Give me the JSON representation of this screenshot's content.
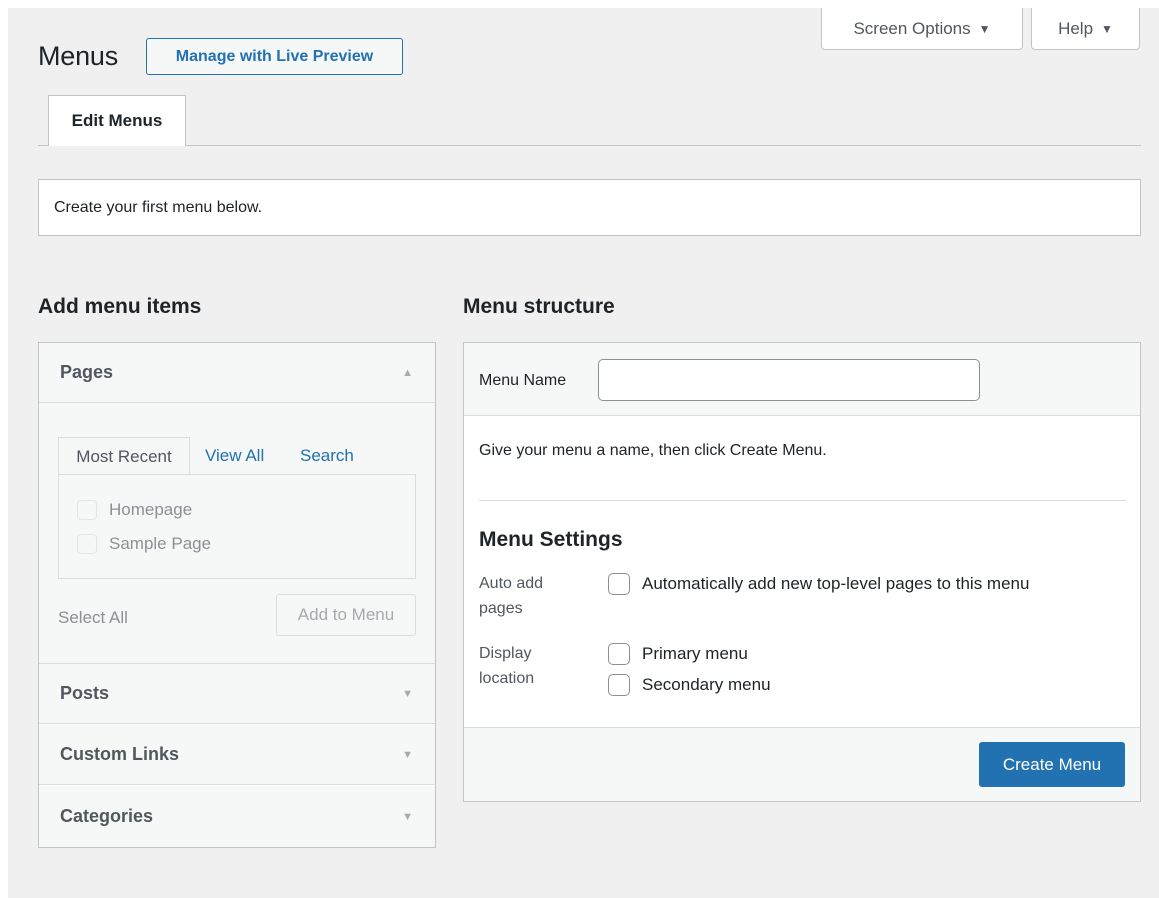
{
  "header": {
    "title": "Menus",
    "live_preview_label": "Manage with Live Preview",
    "screen_options_label": "Screen Options",
    "help_label": "Help",
    "dropdown_glyph": "▼"
  },
  "nav_tabs": [
    {
      "label": "Edit Menus",
      "active": true
    }
  ],
  "notice": {
    "text": "Create your first menu below."
  },
  "add_menu_items": {
    "heading": "Add menu items",
    "sections": [
      {
        "title": "Pages",
        "expanded": true,
        "arrow": "▲",
        "subtabs": [
          {
            "label": "Most Recent",
            "active": true
          },
          {
            "label": "View All",
            "active": false
          },
          {
            "label": "Search",
            "active": false
          }
        ],
        "items": [
          "Homepage",
          "Sample Page"
        ],
        "select_all_label": "Select All",
        "add_button_label": "Add to Menu"
      },
      {
        "title": "Posts",
        "expanded": false,
        "arrow": "▼"
      },
      {
        "title": "Custom Links",
        "expanded": false,
        "arrow": "▼"
      },
      {
        "title": "Categories",
        "expanded": false,
        "arrow": "▼"
      }
    ]
  },
  "menu_structure": {
    "heading": "Menu structure",
    "menu_name_label": "Menu Name",
    "menu_name_value": "",
    "instructions": "Give your menu a name, then click Create Menu.",
    "settings_heading": "Menu Settings",
    "auto_add": {
      "label_line1": "Auto add",
      "label_line2": "pages",
      "option": "Automatically add new top-level pages to this menu",
      "checked": false
    },
    "display_location": {
      "label_line1": "Display",
      "label_line2": "location",
      "options": [
        {
          "label": "Primary menu",
          "checked": false
        },
        {
          "label": "Secondary menu",
          "checked": false
        }
      ]
    },
    "create_button_label": "Create Menu"
  },
  "colors": {
    "accent": "#2271b1",
    "background": "#f0f0f1",
    "border": "#c3c4c7"
  }
}
